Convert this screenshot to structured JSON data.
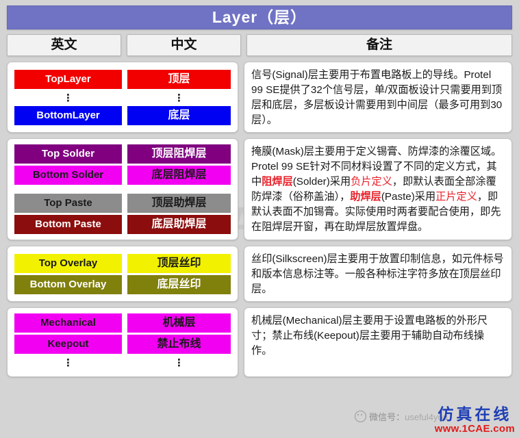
{
  "header": {
    "title": "Layer（层）",
    "title_bg": "#7073c4"
  },
  "columns": [
    {
      "key": "en",
      "label": "英文"
    },
    {
      "key": "cn",
      "label": "中文"
    },
    {
      "key": "note",
      "label": "备注"
    }
  ],
  "sections": [
    {
      "id": "signal",
      "badges": [
        {
          "en": "TopLayer",
          "cn": "顶层",
          "bg": "#f20000",
          "fg": "#ffffff"
        },
        {
          "ellipsis": true
        },
        {
          "en": "BottomLayer",
          "cn": "底层",
          "bg": "#0000f2",
          "fg": "#ffffff"
        }
      ],
      "note_runs": [
        {
          "text": "信号(Signal)层主要用于布置电路板上的导线。Protel 99 SE提供了32个信号层，单/双面板设计只需要用到顶层和底层，多层板设计需要用到中间层（最多可用到30层）。",
          "style": "normal"
        }
      ]
    },
    {
      "id": "mask",
      "badges": [
        {
          "en": "Top Solder",
          "cn": "顶层阻焊层",
          "bg": "#800080",
          "fg": "#ffffff"
        },
        {
          "en": "Bottom Solder",
          "cn": "底层阻焊层",
          "bg": "#f200f2",
          "fg": "#1a1a1a"
        },
        {
          "spacer": true
        },
        {
          "en": "Top Paste",
          "cn": "顶层助焊层",
          "bg": "#8c8c8c",
          "fg": "#1a1a1a"
        },
        {
          "en": "Bottom Paste",
          "cn": "底层助焊层",
          "bg": "#8c0d0d",
          "fg": "#ffffff"
        }
      ],
      "note_runs": [
        {
          "text": "掩膜(Mask)层主要用于定义锡膏、防焊漆的涂覆区域。Protel 99 SE针对不同材料设置了不同的定义方式，其中",
          "style": "normal"
        },
        {
          "text": "阻焊层",
          "style": "red-bold"
        },
        {
          "text": "(Solder)采用",
          "style": "normal"
        },
        {
          "text": "负片定义",
          "style": "red"
        },
        {
          "text": "，即默认表面全部涂覆防焊漆（俗称盖油），",
          "style": "normal"
        },
        {
          "text": "助焊层",
          "style": "red-bold"
        },
        {
          "text": "(Paste)采用",
          "style": "normal"
        },
        {
          "text": "正片定义",
          "style": "red"
        },
        {
          "text": "，即默认表面不加锡膏。实际使用时两者要配合使用，即先在阻焊层开窗，再在助焊层放置焊盘。",
          "style": "normal"
        }
      ]
    },
    {
      "id": "silkscreen",
      "badges": [
        {
          "en": "Top Overlay",
          "cn": "顶层丝印",
          "bg": "#f2f200",
          "fg": "#1a1a1a"
        },
        {
          "en": "Bottom Overlay",
          "cn": "底层丝印",
          "bg": "#80800d",
          "fg": "#ffffff"
        }
      ],
      "note_runs": [
        {
          "text": "丝印(Silkscreen)层主要用于放置印制信息，如元件标号和版本信息标注等。一般各种标注字符多放在顶层丝印层。",
          "style": "normal"
        }
      ]
    },
    {
      "id": "mechanical",
      "badges": [
        {
          "en": "Mechanical",
          "cn": "机械层",
          "bg": "#f200f2",
          "fg": "#1a1a1a"
        },
        {
          "en": "Keepout",
          "cn": "禁止布线",
          "bg": "#f200f2",
          "fg": "#1a1a1a"
        },
        {
          "ellipsis": true
        }
      ],
      "note_runs": [
        {
          "text": "机械层(Mechanical)层主要用于设置电路板的外形尺寸；禁止布线(Keepout)层主要用于辅助自动布线操作。",
          "style": "normal"
        }
      ]
    }
  ],
  "watermarks": {
    "background_text": "1CAE",
    "wechat_label": "微信号：",
    "wechat_handle": "useful4you",
    "brand_cn": "仿真在线",
    "brand_url": "www.1CAE.com"
  }
}
